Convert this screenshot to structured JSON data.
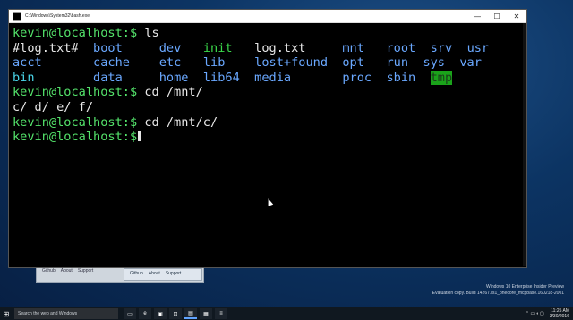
{
  "background_windows": {
    "back": {
      "tabs": [
        "Github",
        "About",
        "Support"
      ]
    },
    "front": {
      "tabs": [
        "Github",
        "About",
        "Support"
      ]
    }
  },
  "terminal": {
    "title": "C:\\Windows\\System32\\bash.exe",
    "controls": {
      "minimize": "—",
      "maximize": "☐",
      "close": "✕"
    },
    "lines": {
      "l1_prompt": "kevin@localhost:$",
      "l1_cmd": " ls",
      "l2": [
        "#log.txt#",
        "boot",
        "dev",
        "init",
        "log.txt",
        "mnt",
        "root",
        "srv",
        "usr"
      ],
      "l3": [
        "acct",
        "cache",
        "etc",
        "lib",
        "lost+found",
        "opt",
        "run",
        "sys",
        "var"
      ],
      "l4": [
        "bin",
        "data",
        "home",
        "lib64",
        "media",
        "proc",
        "sbin",
        "tmp"
      ],
      "l5_prompt": "kevin@localhost:$",
      "l5_cmd": " cd /mnt/",
      "l6": "c/ d/ e/ f/",
      "l7_prompt": "kevin@localhost:$",
      "l7_cmd": " cd /mnt/c/",
      "l8_prompt": "kevin@localhost:$"
    }
  },
  "watermark": {
    "line1": "Windows 10 Enterprise Insider Preview",
    "line2": "Evaluation copy. Build 14267.rs1_onecore_mcpbase.160218-2001"
  },
  "taskbar": {
    "start": "⊞",
    "search_placeholder": "Search the web and Windows",
    "icons": [
      "▭",
      "e",
      "▣",
      "⊡",
      "▤",
      "▦",
      "≡"
    ],
    "time": "11:25 AM",
    "date": "3/30/2016"
  }
}
